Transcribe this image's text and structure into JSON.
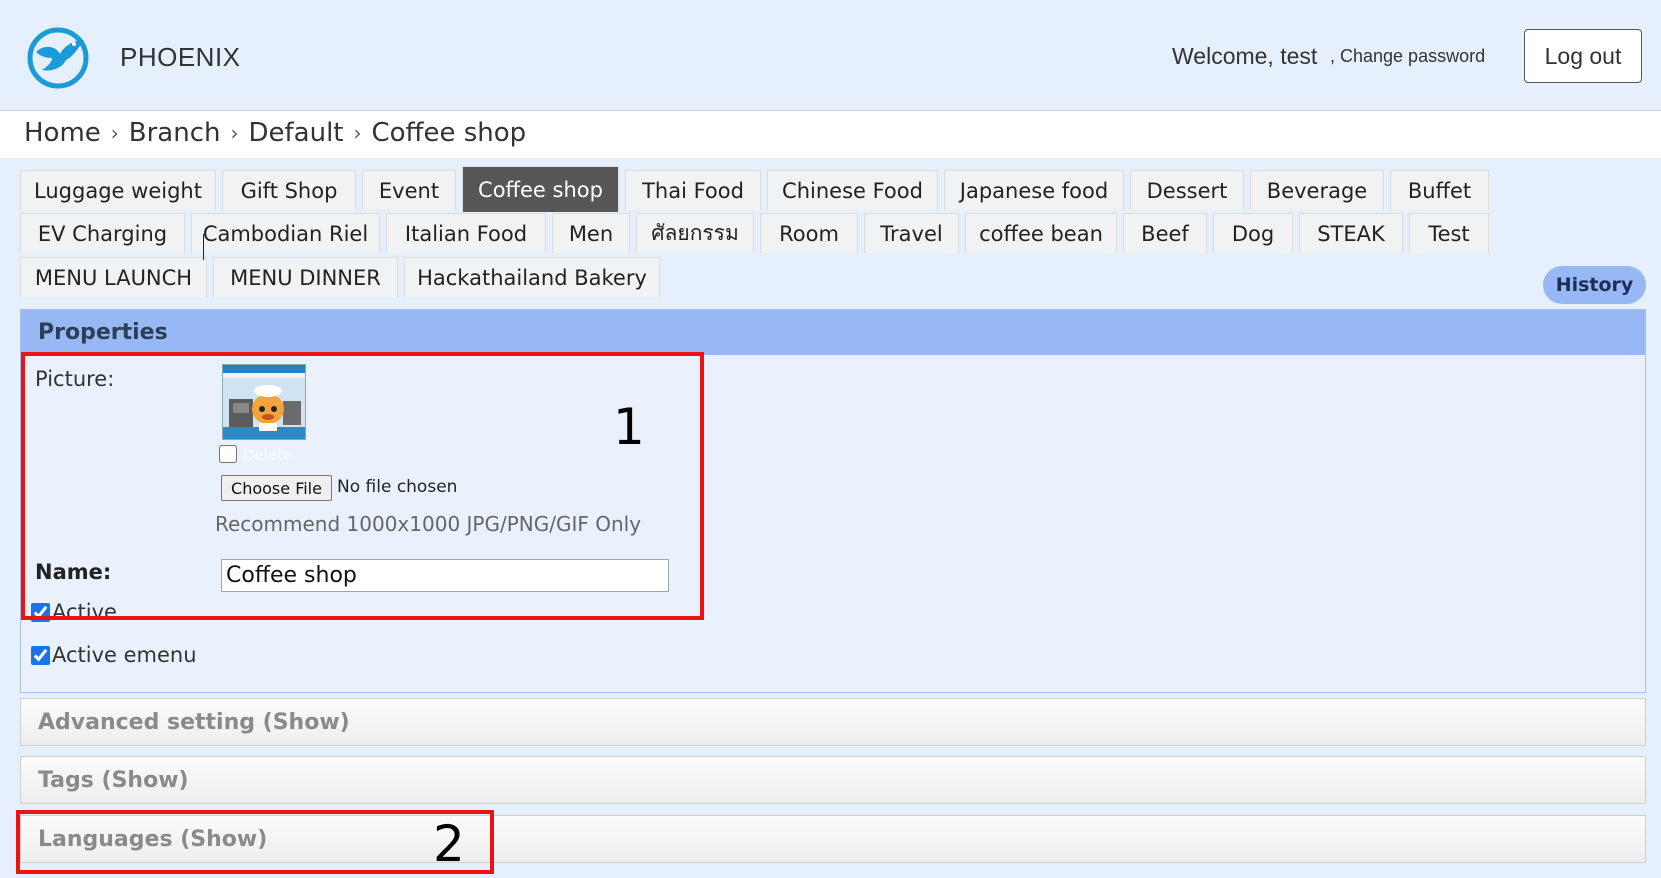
{
  "header": {
    "app_title": "PHOENIX",
    "welcome": "Welcome, test",
    "change_password": ", Change password",
    "logout": "Log out"
  },
  "breadcrumb": [
    "Home",
    "Branch",
    "Default",
    "Coffee shop"
  ],
  "breadcrumb_separator": "›",
  "tabs": [
    "Luggage weight",
    "Gift Shop",
    "Event",
    "Coffee shop",
    "Thai Food",
    "Chinese Food",
    "Japanese food",
    "Dessert",
    "Beverage",
    "Buffet",
    "EV Charging",
    "Cambodian Riel",
    "Italian Food",
    "Men",
    "ศัลยกรรม",
    "Room",
    "Travel",
    "coffee bean",
    "Beef",
    "Dog",
    "STEAK",
    "Test",
    "MENU LAUNCH",
    "MENU DINNER",
    "Hackathailand Bakery"
  ],
  "active_tab": "Coffee shop",
  "history_button": "History",
  "properties": {
    "header": "Properties",
    "picture_label": "Picture:",
    "delete_label": "Delete",
    "delete_checked": false,
    "choose_file": "Choose File",
    "no_file": "No file chosen",
    "recommend": "Recommend 1000x1000 JPG/PNG/GIF Only",
    "name_label": "Name:",
    "name_value": "Coffee shop",
    "active_label": "Active",
    "active_checked": true,
    "active_emenu_label": "Active emenu",
    "active_emenu_checked": true
  },
  "sections": {
    "advanced": "Advanced setting (Show)",
    "tags": "Tags (Show)",
    "languages": "Languages (Show)"
  },
  "annotations": [
    "1",
    "2"
  ],
  "colors": {
    "header_bg": "#e5f0fc",
    "properties_header": "#97b8f5",
    "active_tab": "#565656",
    "highlight_box": "#ee1111",
    "history_button": "#97b8f5"
  },
  "icons": {
    "logo": "phoenix-bird-logo",
    "picture": "coffee-shop-mascot-thumbnail"
  }
}
